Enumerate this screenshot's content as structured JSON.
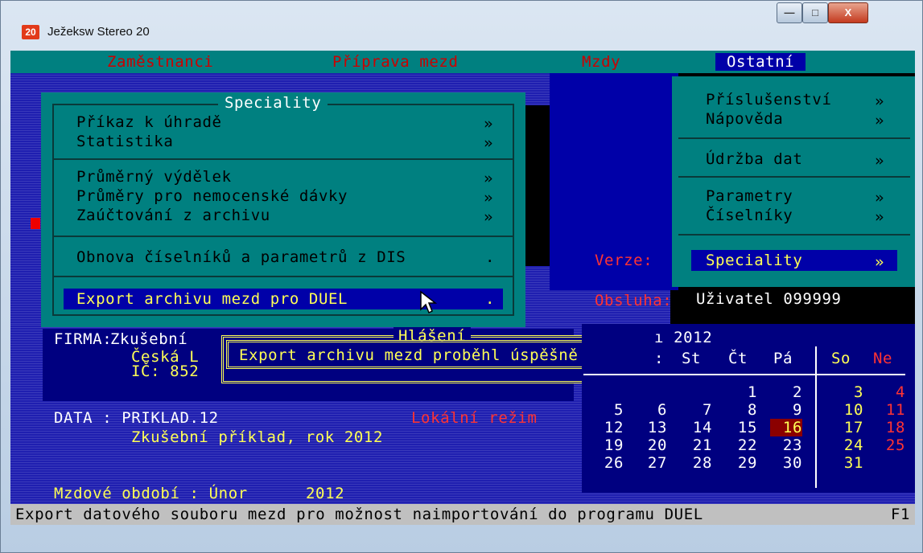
{
  "window": {
    "icon": "20",
    "title": "Ježeksw Stereo 20",
    "buttons": {
      "minimize": "—",
      "maximize": "□",
      "close": "X"
    }
  },
  "menubar": [
    {
      "label": "Zaměstnanci"
    },
    {
      "label": "Příprava mezd"
    },
    {
      "label": "Mzdy"
    },
    {
      "label": "Ostatní",
      "selected": true
    }
  ],
  "ostatni_menu": {
    "items": [
      {
        "label": "Příslušenství",
        "arrow": "»"
      },
      {
        "label": "Nápověda",
        "arrow": "»"
      },
      {
        "label": "Údržba dat",
        "arrow": "»"
      },
      {
        "label": "Parametry",
        "arrow": "»"
      },
      {
        "label": "Číselníky",
        "arrow": "»"
      },
      {
        "label": "Speciality",
        "arrow": "»",
        "selected": true
      }
    ]
  },
  "speciality_menu": {
    "title": "Speciality",
    "items": [
      {
        "label": "Příkaz k úhradě",
        "arrow": "»"
      },
      {
        "label": "Statistika",
        "arrow": "»"
      },
      {
        "label": "Průměrný výdělek",
        "arrow": "»"
      },
      {
        "label": "Průměry pro nemocenské dávky",
        "arrow": "»"
      },
      {
        "label": "Zaúčtování z archivu",
        "arrow": "»"
      },
      {
        "label": "Obnova číselníků a parametrů z DIS",
        "arrow": "."
      },
      {
        "label": "Export archivu mezd pro DUEL",
        "arrow": ".",
        "selected": true
      }
    ]
  },
  "info": {
    "verze_label": "Verze:",
    "obsluha_label": "Obsluha:",
    "obsluha_value": "Uživatel 099999",
    "firma_label": "FIRMA:",
    "firma_value": "Zkušební",
    "firma_line2": "Česká L",
    "ico_line": "IČ: 852",
    "data_label": "DATA : PRIKLAD.12",
    "data_desc": "Zkušební příklad, rok 2012",
    "mode": "Lokální režim",
    "period": "Mzdové období : Únor      2012"
  },
  "dialog": {
    "title": "Hlášení",
    "message": "Export archivu mezd proběhl úspěšně"
  },
  "calendar": {
    "month_label": "ı 2012",
    "headers": [
      "St",
      "Čt",
      "Pá",
      "So",
      "Ne"
    ],
    "header_sep": ":",
    "rows": [
      [
        "",
        "",
        "1",
        "2",
        "3",
        "4"
      ],
      [
        "5",
        "6",
        "7",
        "8",
        "9",
        "10",
        "11"
      ],
      [
        "12",
        "13",
        "14",
        "15",
        "16",
        "17",
        "18"
      ],
      [
        "19",
        "20",
        "21",
        "22",
        "23",
        "24",
        "25"
      ],
      [
        "26",
        "27",
        "28",
        "29",
        "30",
        "31",
        ""
      ]
    ],
    "today": "16"
  },
  "statusbar": {
    "text": "Export datového souboru mezd pro možnost naimportování do programu DUEL",
    "key": "F1"
  },
  "colors": {
    "teal": "#008080",
    "blue": "#0000a8",
    "red": "#ff3333",
    "yellow": "#ffff55"
  }
}
